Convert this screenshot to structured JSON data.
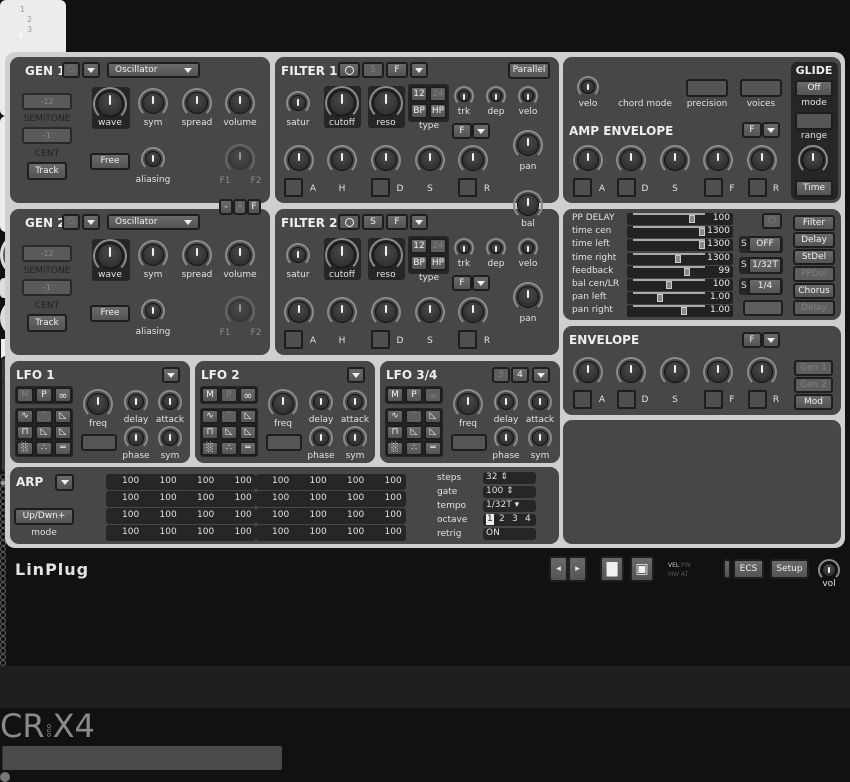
{
  "gens": [
    {
      "title": "GEN 1",
      "type": "Oscillator",
      "semitone": "-12",
      "semitone_label": "SEMITONE",
      "cent": "-1",
      "cent_label": "CENT",
      "track": "Track",
      "free": "Free",
      "wave": "wave",
      "sym": "sym",
      "spread": "spread",
      "volume": "volume",
      "aliasing": "aliasing",
      "f1": "F1",
      "f2": "F2"
    },
    {
      "title": "GEN 2",
      "type": "Oscillator",
      "semitone": "-12",
      "semitone_label": "SEMITONE",
      "cent": "-1",
      "cent_label": "CENT",
      "track": "Track",
      "free": "Free",
      "wave": "wave",
      "sym": "sym",
      "spread": "spread",
      "volume": "volume",
      "aliasing": "aliasing",
      "f1": "F1",
      "f2": "F2"
    }
  ],
  "gen_selector": [
    "1",
    "2",
    "3",
    "4"
  ],
  "link_buttons": [
    "-",
    "A",
    "F"
  ],
  "filters": [
    {
      "title": "FILTER 1",
      "buttons": [
        {
          "label": "S",
          "active": false
        },
        {
          "label": "F",
          "active": true
        }
      ],
      "parallel": "Parallel",
      "satur": "satur",
      "cutoff": "cutoff",
      "reso": "reso",
      "type_buttons": [
        {
          "label": "12",
          "active": true
        },
        {
          "label": "24",
          "active": false
        },
        {
          "label": "BP",
          "active": true
        },
        {
          "label": "HP",
          "active": true
        }
      ],
      "type": "type",
      "trk": "trk",
      "dep": "dep",
      "velo": "velo",
      "env_mode": "F",
      "pan": "pan",
      "env_labels": [
        "A",
        "H",
        "D",
        "S",
        "R"
      ]
    },
    {
      "title": "FILTER 2",
      "buttons": [
        {
          "label": "S",
          "active": true
        },
        {
          "label": "F",
          "active": true
        }
      ],
      "satur": "satur",
      "cutoff": "cutoff",
      "reso": "reso",
      "type_buttons": [
        {
          "label": "12",
          "active": true
        },
        {
          "label": "24",
          "active": false
        },
        {
          "label": "BP",
          "active": true
        },
        {
          "label": "HP",
          "active": true
        }
      ],
      "type": "type",
      "trk": "trk",
      "dep": "dep",
      "velo": "velo",
      "env_mode": "F",
      "pan": "pan",
      "env_labels": [
        "A",
        "H",
        "D",
        "S",
        "R"
      ]
    }
  ],
  "bal": "bal",
  "global": {
    "velo": "velo",
    "chord_mode": "chord mode",
    "precision": "precision",
    "voices": "voices"
  },
  "amp_env": {
    "title": "AMP ENVELOPE",
    "mode": "F",
    "labels": [
      "A",
      "D",
      "S",
      "F",
      "R"
    ]
  },
  "glide": {
    "title": "GLIDE",
    "mode_value": "Off",
    "mode": "mode",
    "range": "range",
    "time": "Time"
  },
  "delay": {
    "rows": [
      {
        "label": "PP DELAY",
        "value": "100",
        "level": 0.85
      },
      {
        "label": "time cen",
        "value": "1300",
        "level": 1.0
      },
      {
        "label": "time left",
        "value": "1300",
        "level": 1.0
      },
      {
        "label": "time right",
        "value": "1300",
        "level": 0.64
      },
      {
        "label": "feedback",
        "value": "99",
        "level": 0.78
      },
      {
        "label": "bal cen/LR",
        "value": "100",
        "level": 0.5
      },
      {
        "label": "pan left",
        "value": "1.00",
        "level": 0.37
      },
      {
        "label": "pan right",
        "value": "1.00",
        "level": 0.72
      }
    ],
    "sync": [
      {
        "s": "S",
        "value": "OFF"
      },
      {
        "s": "S",
        "value": "1/32T"
      },
      {
        "s": "S",
        "value": "1/4"
      }
    ],
    "fx_buttons": [
      {
        "label": "Filter",
        "active": true
      },
      {
        "label": "Delay",
        "active": true
      },
      {
        "label": "StDel",
        "active": true
      },
      {
        "label": "PPDel",
        "active": false
      },
      {
        "label": "Chorus",
        "active": true
      },
      {
        "label": "Delay",
        "active": false
      }
    ]
  },
  "envelope": {
    "title": "ENVELOPE",
    "mode": "F",
    "labels": [
      "A",
      "D",
      "S",
      "F",
      "R"
    ],
    "targets": [
      {
        "label": "Gen 1",
        "active": false
      },
      {
        "label": "Gen 2",
        "active": false
      },
      {
        "label": "Mod",
        "active": true
      }
    ]
  },
  "lfos": [
    {
      "title": "LFO 1",
      "modes": [
        {
          "label": "M",
          "active": false
        },
        {
          "label": "P",
          "active": true
        }
      ],
      "loop_active": true,
      "freq": "freq",
      "delay": "delay",
      "attack": "attack",
      "phase": "phase",
      "sym": "sym"
    },
    {
      "title": "LFO 2",
      "modes": [
        {
          "label": "M",
          "active": true
        },
        {
          "label": "P",
          "active": false
        }
      ],
      "loop_active": true,
      "freq": "freq",
      "delay": "delay",
      "attack": "attack",
      "phase": "phase",
      "sym": "sym"
    },
    {
      "title": "LFO 3/4",
      "selector": [
        {
          "label": "3",
          "active": false
        },
        {
          "label": "4",
          "active": true
        }
      ],
      "modes": [
        {
          "label": "M",
          "active": true
        },
        {
          "label": "P",
          "active": true
        }
      ],
      "loop_active": false,
      "freq": "freq",
      "delay": "delay",
      "attack": "attack",
      "phase": "phase",
      "sym": "sym"
    }
  ],
  "arp": {
    "title": "ARP",
    "mode_value": "Up/Dwn+",
    "mode": "mode",
    "active_step": 1,
    "steps": [
      [
        "100",
        "100",
        "100",
        "100",
        "100",
        "100",
        "100",
        "100"
      ],
      [
        "100",
        "100",
        "100",
        "100",
        "100",
        "100",
        "100",
        "100"
      ],
      [
        "100",
        "100",
        "100",
        "100",
        "100",
        "100",
        "100",
        "100"
      ],
      [
        "100",
        "100",
        "100",
        "100",
        "100",
        "100",
        "100",
        "100"
      ]
    ],
    "params": [
      {
        "label": "steps",
        "value": "32 ⇕"
      },
      {
        "label": "gate",
        "value": "100 ⇕"
      },
      {
        "label": "tempo",
        "value": "1/32T ▾"
      },
      {
        "label": "octave",
        "options": [
          "1",
          "2",
          "3",
          "4"
        ],
        "selected": "1"
      },
      {
        "label": "retrig",
        "value": "ON"
      }
    ]
  },
  "footer": {
    "brand": "LinPlug",
    "logo_left": "CR",
    "logo_mid": "ono",
    "logo_right": "X4",
    "indicators": [
      "VEL",
      "PW",
      "MW",
      "AT"
    ],
    "ecs": "ECS",
    "setup": "Setup",
    "vol": "vol"
  }
}
